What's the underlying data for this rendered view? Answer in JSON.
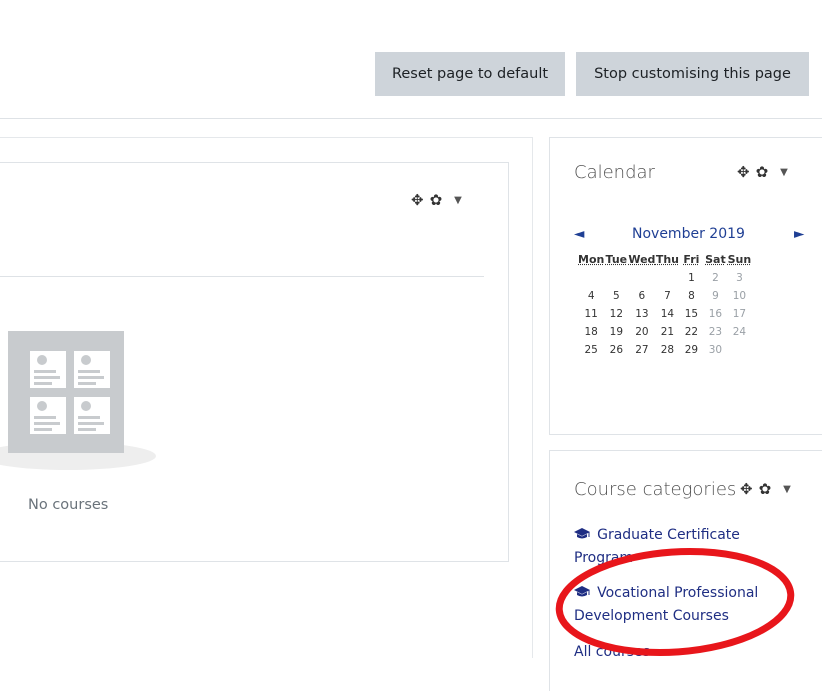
{
  "toolbar": {
    "reset_label": "Reset page to default",
    "stop_label": "Stop customising this page"
  },
  "main_block": {
    "empty_text": "No courses"
  },
  "calendar": {
    "title": "Calendar",
    "prev_glyph": "◄",
    "next_glyph": "►",
    "month": "November 2019",
    "weekdays": [
      "Mon",
      "Tue",
      "Wed",
      "Thu",
      "Fri",
      "Sat",
      "Sun"
    ],
    "weeks": [
      [
        "",
        "",
        "",
        "",
        "1",
        "2",
        "3"
      ],
      [
        "4",
        "5",
        "6",
        "7",
        "8",
        "9",
        "10"
      ],
      [
        "11",
        "12",
        "13",
        "14",
        "15",
        "16",
        "17"
      ],
      [
        "18",
        "19",
        "20",
        "21",
        "22",
        "23",
        "24"
      ],
      [
        "25",
        "26",
        "27",
        "28",
        "29",
        "30",
        ""
      ]
    ]
  },
  "course_categories": {
    "title": "Course categories",
    "items": [
      {
        "label": "Graduate Certificate Program"
      },
      {
        "label": "Vocational Professional Development Courses"
      }
    ],
    "all_link": "All courses"
  },
  "annotation": {
    "color": "#e8161b"
  }
}
